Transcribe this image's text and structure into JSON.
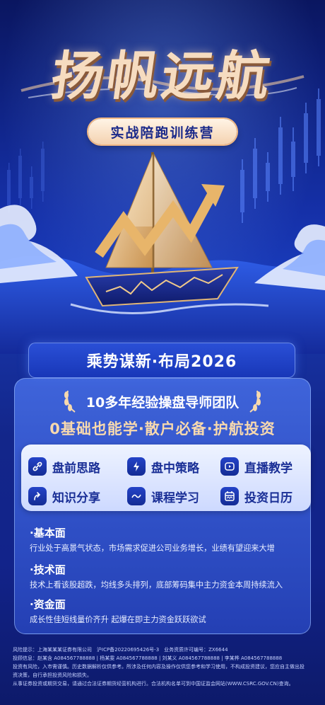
{
  "header": {
    "title": "扬帆远航",
    "subtitle": "实战陪跑训练营"
  },
  "headline": "乘势谋新·布局2026",
  "team": {
    "line": "10多年经验操盘导师团队",
    "slogan": "0基础也能学·散户必备·护航投资"
  },
  "features": [
    {
      "label": "盘前思路",
      "icon": "link-icon"
    },
    {
      "label": "盘中策略",
      "icon": "lightning-icon"
    },
    {
      "label": "直播教学",
      "icon": "play-icon"
    },
    {
      "label": "知识分享",
      "icon": "share-arrow-icon"
    },
    {
      "label": "课程学习",
      "icon": "wave-icon"
    },
    {
      "label": "投资日历",
      "icon": "calendar-icon"
    }
  ],
  "sections": [
    {
      "title": "·基本面",
      "body": "行业处于高景气状态，市场需求促进公司业务增长，业绩有望迎来大增"
    },
    {
      "title": "·技术面",
      "body": "技术上看该股超跌，均线多头排列，底部筹码集中主力资金本周持续流入"
    },
    {
      "title": "·资金面",
      "body": "成长性佳短线量价齐升 起爆在即主力资金跃跃欲试"
    }
  ],
  "disclaimer": [
    "风险提示：上海某某某证券有限公司　沪ICP备20220695426号-3　业务资质许可编号：ZX6644",
    "投顾信息：赵某含 A084567788888 | 杨某雯 A084567788888 | 刘某义 A084567788888 | 李某桦 A084567788888",
    "投资有风险，入市需谨慎。历史数据解析仅供参考。所涉及任何内容及操作仅供您参考和学习使用，不构成投资建议，您应自主做出投",
    "资决策，自行承担投资风险和损失。",
    "从事证券投资或期货交易，请通过合法证券期货经营机构进行。合法机构名单可到中国证监会网站(WWW.CSRC.GOV.CN)查询。"
  ],
  "colors": {
    "background": "#1530a8",
    "accent_gold": "#f7d9ae",
    "feature_text": "#1a2f96"
  }
}
